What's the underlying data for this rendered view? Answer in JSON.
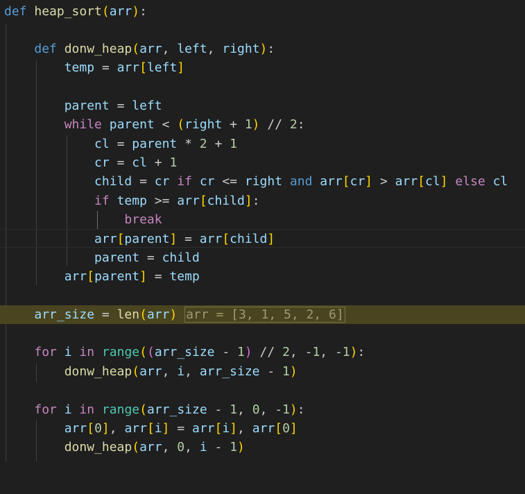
{
  "editor": {
    "inline_value_hint": "arr = [3, 1, 5, 2, 6]"
  },
  "tokens": {
    "def": "def",
    "heap_sort": "heap_sort",
    "donw_heap": "donw_heap",
    "arr": "arr",
    "left": "left",
    "right": "right",
    "temp": "temp",
    "parent": "parent",
    "while": "while",
    "cl": "cl",
    "cr": "cr",
    "child": "child",
    "if": "if",
    "and": "and",
    "else": "else",
    "break": "break",
    "arr_size": "arr_size",
    "len": "len",
    "for": "for",
    "i": "i",
    "in": "in",
    "range": "range"
  }
}
